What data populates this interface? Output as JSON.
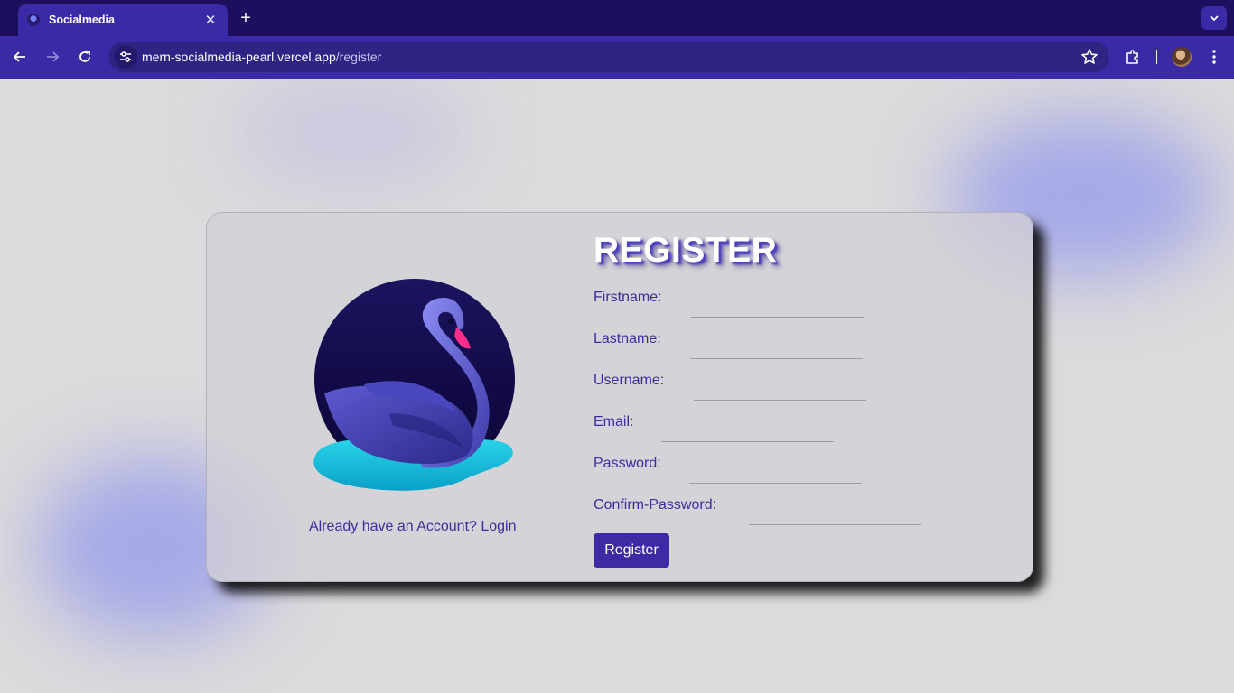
{
  "browser": {
    "tab_title": "Socialmedia",
    "url_host": "mern-socialmedia-pearl.vercel.app",
    "url_path": "/register",
    "colors": {
      "tabbar": "#1e0f5e",
      "toolbar": "#3b2aa6",
      "omnibox": "#2f2383"
    }
  },
  "page": {
    "logo_icon": "swan-logo",
    "heading": "REGISTER",
    "fields": [
      {
        "label": "Firstname:",
        "value": ""
      },
      {
        "label": "Lastname:",
        "value": ""
      },
      {
        "label": "Username:",
        "value": ""
      },
      {
        "label": "Email:",
        "value": ""
      },
      {
        "label": "Password:",
        "value": ""
      },
      {
        "label": "Confirm-Password:",
        "value": ""
      }
    ],
    "submit_label": "Register",
    "login_link": "Already have an Account? Login",
    "colors": {
      "accent": "#3f2aa6",
      "text": "#3a2ea0",
      "background": "#dcdadc"
    }
  }
}
